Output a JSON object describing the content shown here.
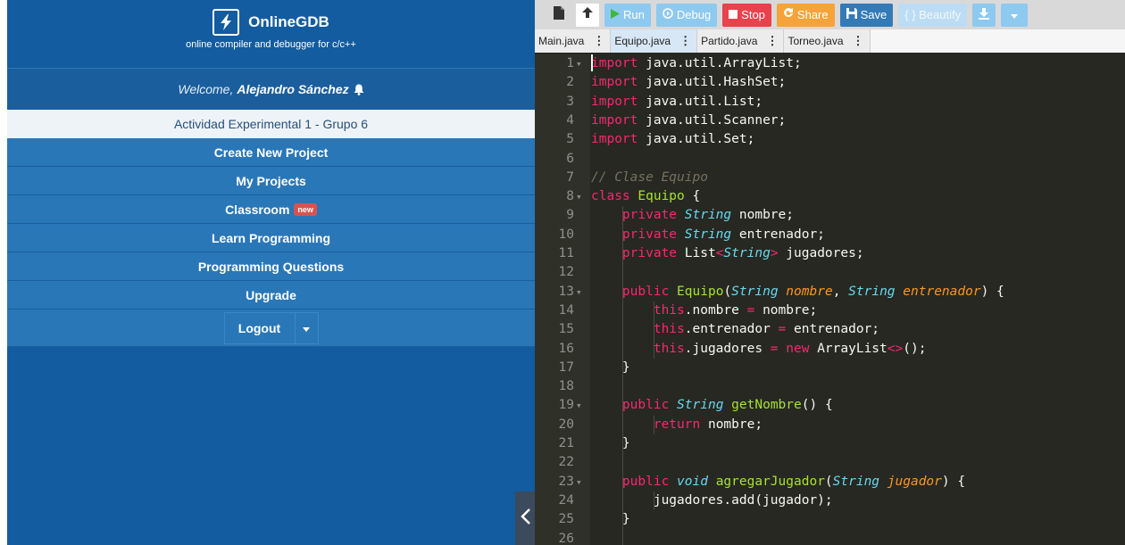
{
  "app": {
    "name": "OnlineGDB",
    "tagline": "online compiler and debugger for c/c++"
  },
  "user": {
    "welcome_label": "Welcome,",
    "name": "Alejandro Sánchez"
  },
  "project": {
    "title": "Actividad Experimental 1 - Grupo 6"
  },
  "menu": {
    "create": "Create New Project",
    "my_projects": "My Projects",
    "classroom": "Classroom",
    "classroom_badge": "new",
    "learn": "Learn Programming",
    "questions": "Programming Questions",
    "upgrade": "Upgrade",
    "logout": "Logout"
  },
  "toolbar": {
    "run": "Run",
    "debug": "Debug",
    "stop": "Stop",
    "share": "Share",
    "save": "Save",
    "beautify": "{ } Beautify"
  },
  "tabs": [
    {
      "label": "Main.java",
      "active": false
    },
    {
      "label": "Equipo.java",
      "active": true
    },
    {
      "label": "Partido.java",
      "active": false
    },
    {
      "label": "Torneo.java",
      "active": false
    }
  ],
  "colors": {
    "sidebar_bg": "#135c9f",
    "menu_item_bg": "#2a77b8",
    "editor_bg": "#272822",
    "keyword": "#f92672",
    "type": "#66d9ef",
    "function": "#a6e22e",
    "argument": "#fd971f",
    "comment": "#75715e"
  },
  "code": {
    "language": "java",
    "lines": [
      {
        "n": "1",
        "fold": true,
        "tokens": [
          [
            "kw",
            "import"
          ],
          [
            "t",
            " java.util.ArrayList;"
          ]
        ]
      },
      {
        "n": "2",
        "tokens": [
          [
            "kw",
            "import"
          ],
          [
            "t",
            " java.util.HashSet;"
          ]
        ]
      },
      {
        "n": "3",
        "tokens": [
          [
            "kw",
            "import"
          ],
          [
            "t",
            " java.util.List;"
          ]
        ]
      },
      {
        "n": "4",
        "tokens": [
          [
            "kw",
            "import"
          ],
          [
            "t",
            " java.util.Scanner;"
          ]
        ]
      },
      {
        "n": "5",
        "tokens": [
          [
            "kw",
            "import"
          ],
          [
            "t",
            " java.util.Set;"
          ]
        ]
      },
      {
        "n": "6",
        "tokens": []
      },
      {
        "n": "7",
        "tokens": [
          [
            "cm",
            "// Clase Equipo"
          ]
        ]
      },
      {
        "n": "8",
        "fold": true,
        "tokens": [
          [
            "kw",
            "class"
          ],
          [
            "t",
            " "
          ],
          [
            "fn",
            "Equipo"
          ],
          [
            "t",
            " {"
          ]
        ]
      },
      {
        "n": "9",
        "tokens": [
          [
            "t",
            "    "
          ],
          [
            "kw",
            "private"
          ],
          [
            "t",
            " "
          ],
          [
            "ty",
            "String"
          ],
          [
            "t",
            " nombre;"
          ]
        ]
      },
      {
        "n": "10",
        "tokens": [
          [
            "t",
            "    "
          ],
          [
            "kw",
            "private"
          ],
          [
            "t",
            " "
          ],
          [
            "ty",
            "String"
          ],
          [
            "t",
            " entrenador;"
          ]
        ]
      },
      {
        "n": "11",
        "tokens": [
          [
            "t",
            "    "
          ],
          [
            "kw",
            "private"
          ],
          [
            "t",
            " List"
          ],
          [
            "kw",
            "<"
          ],
          [
            "ty",
            "String"
          ],
          [
            "kw",
            ">"
          ],
          [
            "t",
            " jugadores;"
          ]
        ]
      },
      {
        "n": "12",
        "tokens": []
      },
      {
        "n": "13",
        "fold": true,
        "tokens": [
          [
            "t",
            "    "
          ],
          [
            "kw",
            "public"
          ],
          [
            "t",
            " "
          ],
          [
            "fn",
            "Equipo"
          ],
          [
            "t",
            "("
          ],
          [
            "ty",
            "String"
          ],
          [
            "t",
            " "
          ],
          [
            "ar",
            "nombre"
          ],
          [
            "t",
            ", "
          ],
          [
            "ty",
            "String"
          ],
          [
            "t",
            " "
          ],
          [
            "ar",
            "entrenador"
          ],
          [
            "t",
            ") {"
          ]
        ]
      },
      {
        "n": "14",
        "tokens": [
          [
            "t",
            "        "
          ],
          [
            "kw",
            "this"
          ],
          [
            "t",
            ".nombre "
          ],
          [
            "kw",
            "="
          ],
          [
            "t",
            " nombre;"
          ]
        ]
      },
      {
        "n": "15",
        "tokens": [
          [
            "t",
            "        "
          ],
          [
            "kw",
            "this"
          ],
          [
            "t",
            ".entrenador "
          ],
          [
            "kw",
            "="
          ],
          [
            "t",
            " entrenador;"
          ]
        ]
      },
      {
        "n": "16",
        "tokens": [
          [
            "t",
            "        "
          ],
          [
            "kw",
            "this"
          ],
          [
            "t",
            ".jugadores "
          ],
          [
            "kw",
            "="
          ],
          [
            "t",
            " "
          ],
          [
            "kw",
            "new"
          ],
          [
            "t",
            " ArrayList"
          ],
          [
            "kw",
            "<>"
          ],
          [
            "t",
            "();"
          ]
        ]
      },
      {
        "n": "17",
        "tokens": [
          [
            "t",
            "    }"
          ]
        ]
      },
      {
        "n": "18",
        "tokens": []
      },
      {
        "n": "19",
        "fold": true,
        "tokens": [
          [
            "t",
            "    "
          ],
          [
            "kw",
            "public"
          ],
          [
            "t",
            " "
          ],
          [
            "ty",
            "String"
          ],
          [
            "t",
            " "
          ],
          [
            "fn",
            "getNombre"
          ],
          [
            "t",
            "() {"
          ]
        ]
      },
      {
        "n": "20",
        "tokens": [
          [
            "t",
            "        "
          ],
          [
            "kw",
            "return"
          ],
          [
            "t",
            " nombre;"
          ]
        ]
      },
      {
        "n": "21",
        "tokens": [
          [
            "t",
            "    }"
          ]
        ]
      },
      {
        "n": "22",
        "tokens": []
      },
      {
        "n": "23",
        "fold": true,
        "tokens": [
          [
            "t",
            "    "
          ],
          [
            "kw",
            "public"
          ],
          [
            "t",
            " "
          ],
          [
            "ty",
            "void"
          ],
          [
            "t",
            " "
          ],
          [
            "fn",
            "agregarJugador"
          ],
          [
            "t",
            "("
          ],
          [
            "ty",
            "String"
          ],
          [
            "t",
            " "
          ],
          [
            "ar",
            "jugador"
          ],
          [
            "t",
            ") {"
          ]
        ]
      },
      {
        "n": "24",
        "tokens": [
          [
            "t",
            "        jugadores.add(jugador);"
          ]
        ]
      },
      {
        "n": "25",
        "tokens": [
          [
            "t",
            "    }"
          ]
        ]
      },
      {
        "n": "26",
        "tokens": []
      }
    ]
  }
}
